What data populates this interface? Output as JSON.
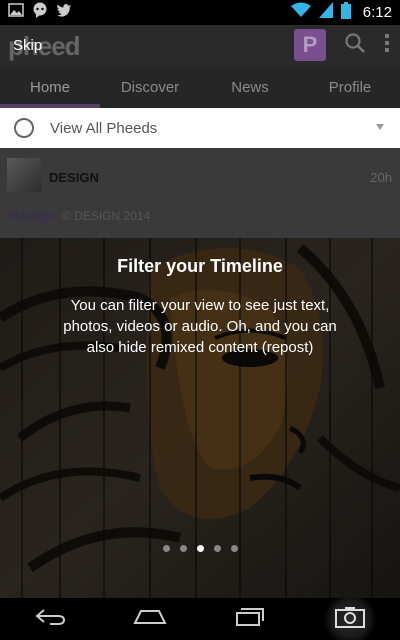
{
  "status_bar": {
    "time": "6:12",
    "icons": [
      "gallery-icon",
      "chat-icon",
      "twitter-icon",
      "wifi-icon",
      "signal-icon",
      "battery-icon"
    ]
  },
  "app_bar": {
    "logo": "pheed",
    "badge_letter": "P",
    "icons": [
      "search-icon",
      "overflow-menu-icon"
    ]
  },
  "tabs": [
    {
      "label": "Home",
      "active": true
    },
    {
      "label": "Discover",
      "active": false
    },
    {
      "label": "News",
      "active": false
    },
    {
      "label": "Profile",
      "active": false
    }
  ],
  "filter": {
    "label": "View All Pheeds"
  },
  "post": {
    "author": "DESIGN",
    "time": "20h",
    "hashtag": "#Design",
    "copyright": "© DESIGN 2014"
  },
  "tour": {
    "skip_label": "Skip",
    "title": "Filter your Timeline",
    "body": "You can filter your view to see just text, photos, videos or audio. Oh, and you can also hide remixed content (repost)",
    "page_count": 5,
    "current_page": 3
  },
  "nav_bar": {
    "icons": [
      "back-icon",
      "home-icon",
      "recents-icon",
      "camera-icon"
    ]
  },
  "colors": {
    "accent": "#55406a",
    "badge": "#7a4f8f"
  }
}
